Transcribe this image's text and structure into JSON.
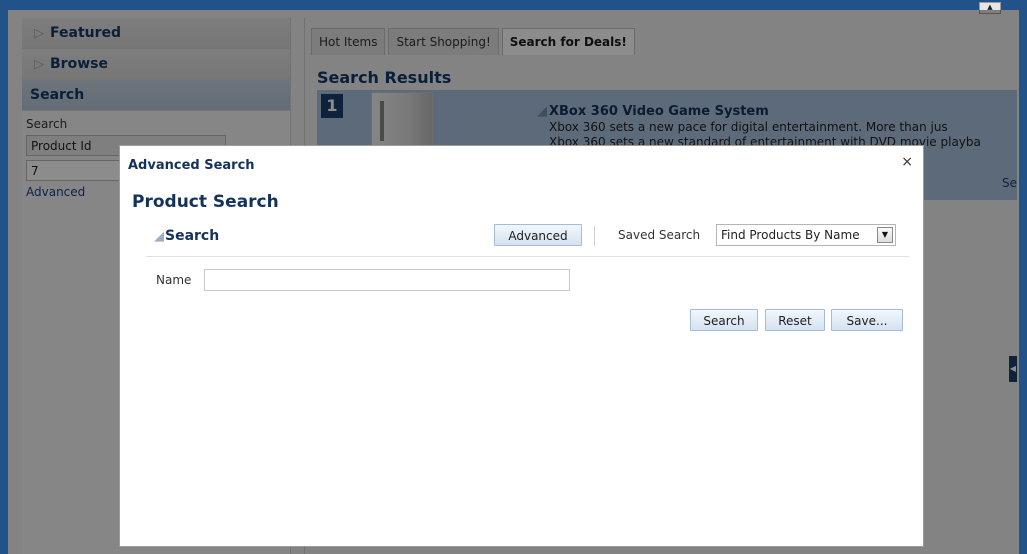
{
  "sidebar": {
    "featured_label": "Featured",
    "browse_label": "Browse",
    "search_label": "Search",
    "search_sub_label": "Search",
    "product_id_label": "Product Id",
    "product_id_value": "7",
    "advanced_link": "Advanced"
  },
  "tabs": [
    {
      "label": "Hot Items"
    },
    {
      "label": "Start Shopping!"
    },
    {
      "label": "Search for Deals!",
      "selected": true
    }
  ],
  "results": {
    "title": "Search Results",
    "rank": "1",
    "product_title": "XBox 360 Video Game System",
    "product_desc": "Xbox 360 sets a new pace for digital entertainment. More than jus",
    "product_desc2": "Xbox 360 sets a new standard of entertainment with DVD movie playba",
    "more_link": "Se"
  },
  "dialog": {
    "title": "Advanced Search",
    "close_glyph": "×",
    "product_search_title": "Product Search",
    "search_section_label": "Search",
    "advanced_button": "Advanced",
    "saved_search_label": "Saved Search",
    "saved_search_value": "Find Products By Name",
    "name_label": "Name",
    "name_value": "",
    "search_button": "Search",
    "reset_button": "Reset",
    "save_button": "Save..."
  },
  "icons": {
    "collapsed": "chevron-right-icon",
    "expanded": "triangle-expanded-icon",
    "close": "close-icon",
    "dropdown": "dropdown-arrow-icon"
  },
  "colors": {
    "frame": "#22528a",
    "heading": "#14325a",
    "result_row": "#a9c1dc",
    "button": "#d4e2f1"
  }
}
